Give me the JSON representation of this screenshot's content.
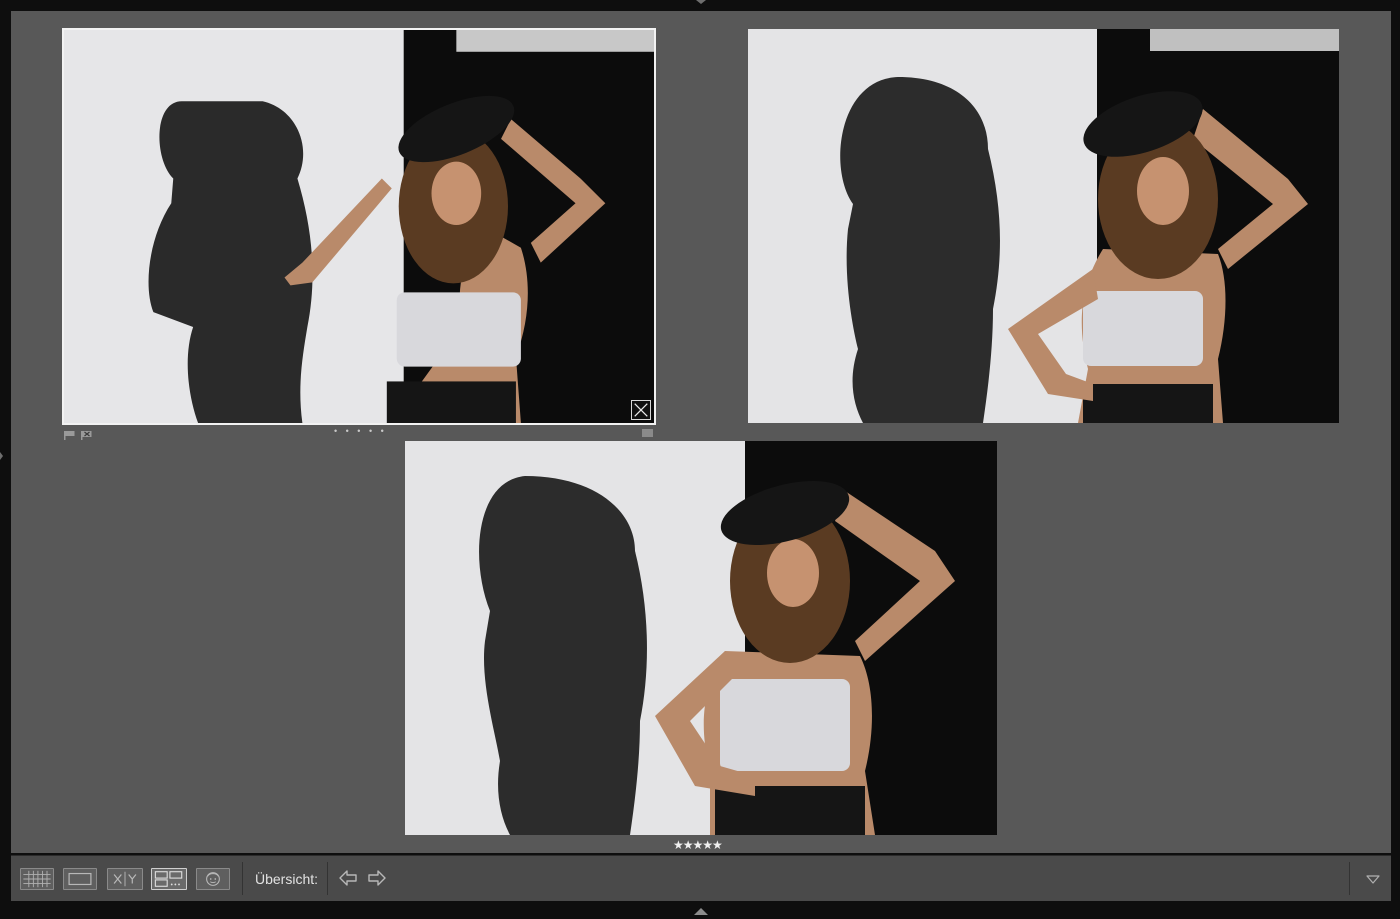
{
  "window": {
    "arrows": [
      "top-panel-toggle",
      "bottom-panel-toggle",
      "left-panel-toggle"
    ]
  },
  "survey": {
    "photos": [
      {
        "name": "photo-1",
        "selected": true,
        "rating_dots": "• • • • •",
        "icons": [
          "flag-icon",
          "reject-flag-icon",
          "close-icon",
          "badge-icon"
        ]
      },
      {
        "name": "photo-2",
        "selected": false
      },
      {
        "name": "photo-3",
        "selected": false,
        "rating_stars": "★★★★★"
      }
    ]
  },
  "toolbar": {
    "buttons": [
      {
        "name": "grid-view-button",
        "icon": "grid-icon"
      },
      {
        "name": "loupe-view-button",
        "icon": "loupe-icon"
      },
      {
        "name": "compare-view-button",
        "icon": "compare-xy-icon",
        "label": "X|Y"
      },
      {
        "name": "survey-view-button",
        "icon": "survey-icon"
      },
      {
        "name": "people-view-button",
        "icon": "face-icon"
      }
    ],
    "overview_label": "Übersicht:",
    "nav": [
      "previous-arrow-icon",
      "next-arrow-icon"
    ],
    "menu_icon": "chevron-down-icon"
  },
  "colors": {
    "background": "#0e0e0e",
    "survey_area": "#585858",
    "toolbar": "#4a4a4a",
    "selection_border": "#f2f2f2"
  }
}
